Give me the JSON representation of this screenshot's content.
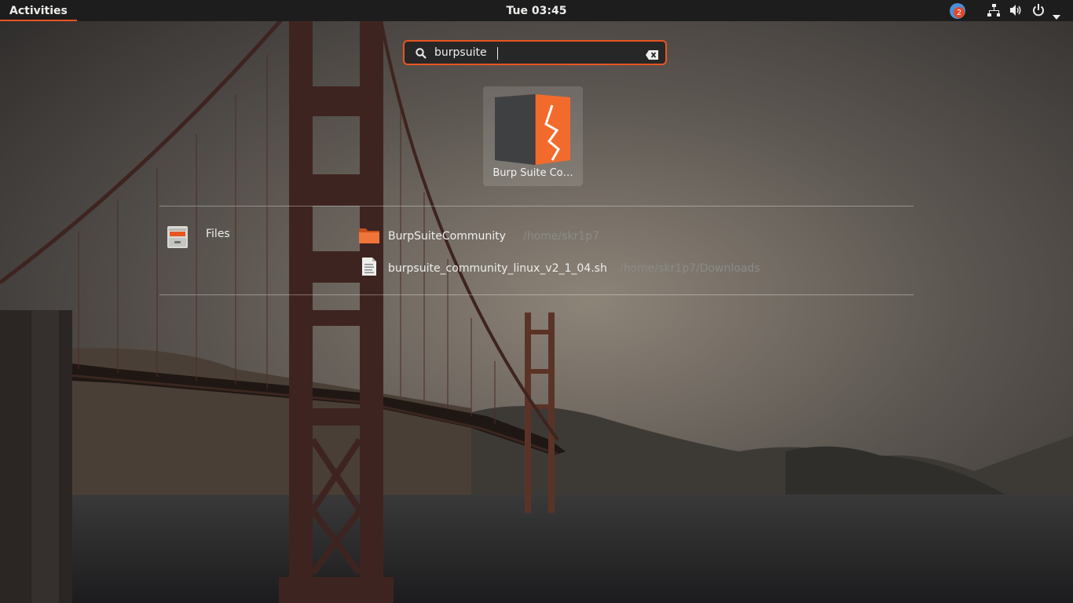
{
  "topbar": {
    "activities_label": "Activities",
    "clock": "Tue 03:45",
    "notification_count": "2",
    "icons": [
      "network-icon",
      "volume-icon",
      "power-icon",
      "chevron-down-icon"
    ]
  },
  "search": {
    "value": "burpsuite"
  },
  "apps": [
    {
      "label": "Burp Suite Co…",
      "icon": "burp-suite-icon"
    }
  ],
  "provider": {
    "label": "Files",
    "icon": "files-app-icon"
  },
  "results": [
    {
      "name": "BurpSuiteCommunity",
      "path": "/home/skr1p7",
      "icon": "folder-icon"
    },
    {
      "name": "burpsuite_community_linux_v2_1_04.sh",
      "path": "/home/skr1p7/Downloads",
      "icon": "text-file-icon"
    }
  ],
  "colors": {
    "accent": "#e95420",
    "topbar": "#1d1d1d",
    "burp_orange": "#f26b2c"
  }
}
